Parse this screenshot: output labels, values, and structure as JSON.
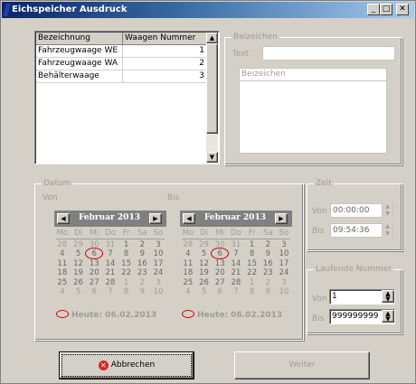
{
  "window": {
    "title": "Eichspeicher Ausdruck",
    "controls": {
      "minimize": "_",
      "maximize": "□",
      "close": "✕"
    }
  },
  "scale_list": {
    "columns": [
      "Bezeichnung",
      "Waagen Nummer"
    ],
    "rows": [
      {
        "name": "Fahrzeugwaage WE",
        "number": "1"
      },
      {
        "name": "Fahrzeugwaage WA",
        "number": "2"
      },
      {
        "name": "Behälterwaage",
        "number": "3"
      }
    ]
  },
  "description_group": {
    "legend": "Beizeichen",
    "text_label": "Text",
    "text_value": "",
    "list_header": "Beizeichen"
  },
  "date_group": {
    "legend": "Datum",
    "from_label": "Von",
    "to_label": "Bis",
    "from_calendar": {
      "month": "Februar 2013",
      "weekdays": [
        "Mo",
        "Di",
        "Mi",
        "Do",
        "Fr",
        "Sa",
        "So"
      ],
      "today_label": "Heute: 06.02.2013"
    },
    "to_calendar": {
      "month": "Februar 2013",
      "weekdays": [
        "Mo",
        "Di",
        "Mi",
        "Do",
        "Fr",
        "Sa",
        "So"
      ],
      "today_label": "Heute: 06.02.2013"
    },
    "weeks": [
      [
        [
          "28",
          0
        ],
        [
          "29",
          0
        ],
        [
          "30",
          0
        ],
        [
          "31",
          0
        ],
        [
          "1",
          1
        ],
        [
          "2",
          1
        ],
        [
          "3",
          1
        ]
      ],
      [
        [
          "4",
          1
        ],
        [
          "5",
          1
        ],
        [
          "6",
          1
        ],
        [
          "7",
          1
        ],
        [
          "8",
          1
        ],
        [
          "9",
          1
        ],
        [
          "10",
          1
        ]
      ],
      [
        [
          "11",
          1
        ],
        [
          "12",
          1
        ],
        [
          "13",
          1
        ],
        [
          "14",
          1
        ],
        [
          "15",
          1
        ],
        [
          "16",
          1
        ],
        [
          "17",
          1
        ]
      ],
      [
        [
          "18",
          1
        ],
        [
          "19",
          1
        ],
        [
          "20",
          1
        ],
        [
          "21",
          1
        ],
        [
          "22",
          1
        ],
        [
          "23",
          1
        ],
        [
          "24",
          1
        ]
      ],
      [
        [
          "25",
          1
        ],
        [
          "26",
          1
        ],
        [
          "27",
          1
        ],
        [
          "28",
          1
        ],
        [
          "1",
          0
        ],
        [
          "2",
          0
        ],
        [
          "3",
          0
        ]
      ],
      [
        [
          "4",
          0
        ],
        [
          "5",
          0
        ],
        [
          "6",
          0
        ],
        [
          "7",
          0
        ],
        [
          "8",
          0
        ],
        [
          "9",
          0
        ],
        [
          "10",
          0
        ]
      ]
    ],
    "selected_day": "6"
  },
  "time_group": {
    "legend": "Zeit",
    "from_label": "Von",
    "from_value": "00:00:00",
    "to_label": "Bis",
    "to_value": "09:54:36"
  },
  "serial_group": {
    "legend": "Laufende Nummer",
    "from_label": "Von",
    "from_value": "1",
    "to_label": "Bis",
    "to_value": "999999999"
  },
  "buttons": {
    "cancel": "Abbrechen",
    "next": "Weiter"
  }
}
